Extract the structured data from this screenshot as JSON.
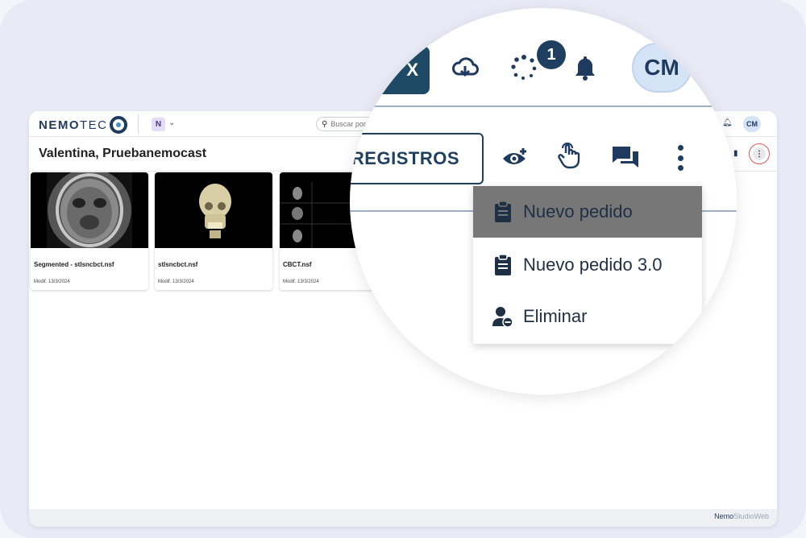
{
  "app": {
    "logo_main": "NEMO",
    "logo_tec": "TEC",
    "org_initial": "N",
    "org_chevron": "⌄",
    "search_placeholder": "Buscar por",
    "avatar_initials": "CM"
  },
  "patient": {
    "name": "Valentina, Pruebanemocast"
  },
  "cards": [
    {
      "name": "Segmented - stlsncbct.nsf",
      "date": "Modif. 13/3/2024"
    },
    {
      "name": "stlsncbct.nsf",
      "date": "Modif. 13/3/2024"
    },
    {
      "name": "CBCT.nsf",
      "date": "Modif. 13/3/2024"
    }
  ],
  "magnified": {
    "dark_button_text": "X",
    "badge_count": "1",
    "avatar_initials": "CM",
    "registros_label": "R REGISTROS",
    "menu": [
      {
        "label": "Nuevo pedido",
        "icon": "clipboard-icon"
      },
      {
        "label": "Nuevo pedido 3.0",
        "icon": "clipboard-icon"
      },
      {
        "label": "Eliminar",
        "icon": "remove-user-icon"
      }
    ]
  },
  "footer": {
    "brand_nemo": "Nemo",
    "brand_studio": "StudioWeb"
  },
  "colors": {
    "primary": "#1e3f5f",
    "highlight_ring": "#e05a5a",
    "selected_menu_bg": "#777777"
  }
}
